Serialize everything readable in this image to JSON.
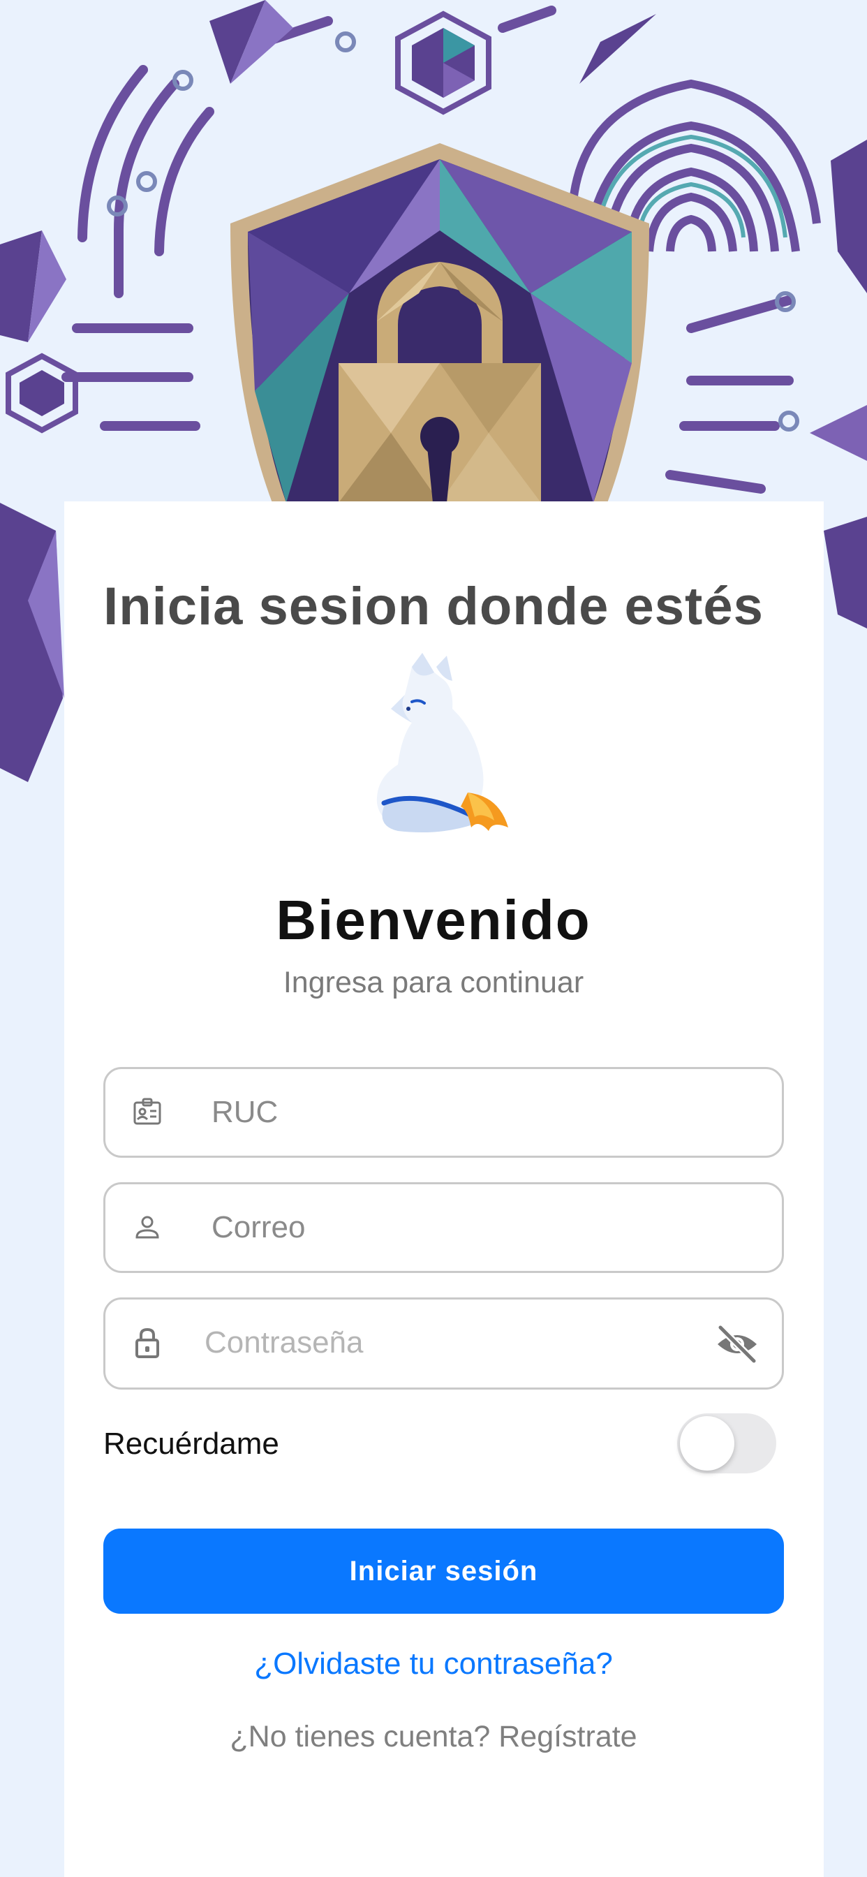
{
  "headline": "Inicia sesion donde estés",
  "welcome": {
    "title": "Bienvenido",
    "subtitle": "Ingresa para continuar"
  },
  "form": {
    "ruc_placeholder": "RUC",
    "email_placeholder": "Correo",
    "password_placeholder": "Contraseña",
    "remember_label": "Recuérdame",
    "remember_enabled": false,
    "submit_label": "Iniciar sesión",
    "forgot_label": "¿Olvidaste tu contraseña?",
    "register_label": "¿No tienes cuenta? Regístrate"
  },
  "icons": {
    "ruc": "id-card-icon",
    "email": "user-icon",
    "password": "lock-icon",
    "visibility": "eye-off-icon"
  },
  "colors": {
    "background": "#eaf2fd",
    "primary": "#0a78ff",
    "card": "#ffffff",
    "shield_purple": "#5b3e8c",
    "shield_teal": "#4fa8ac",
    "lock_gold": "#c9ab78"
  }
}
